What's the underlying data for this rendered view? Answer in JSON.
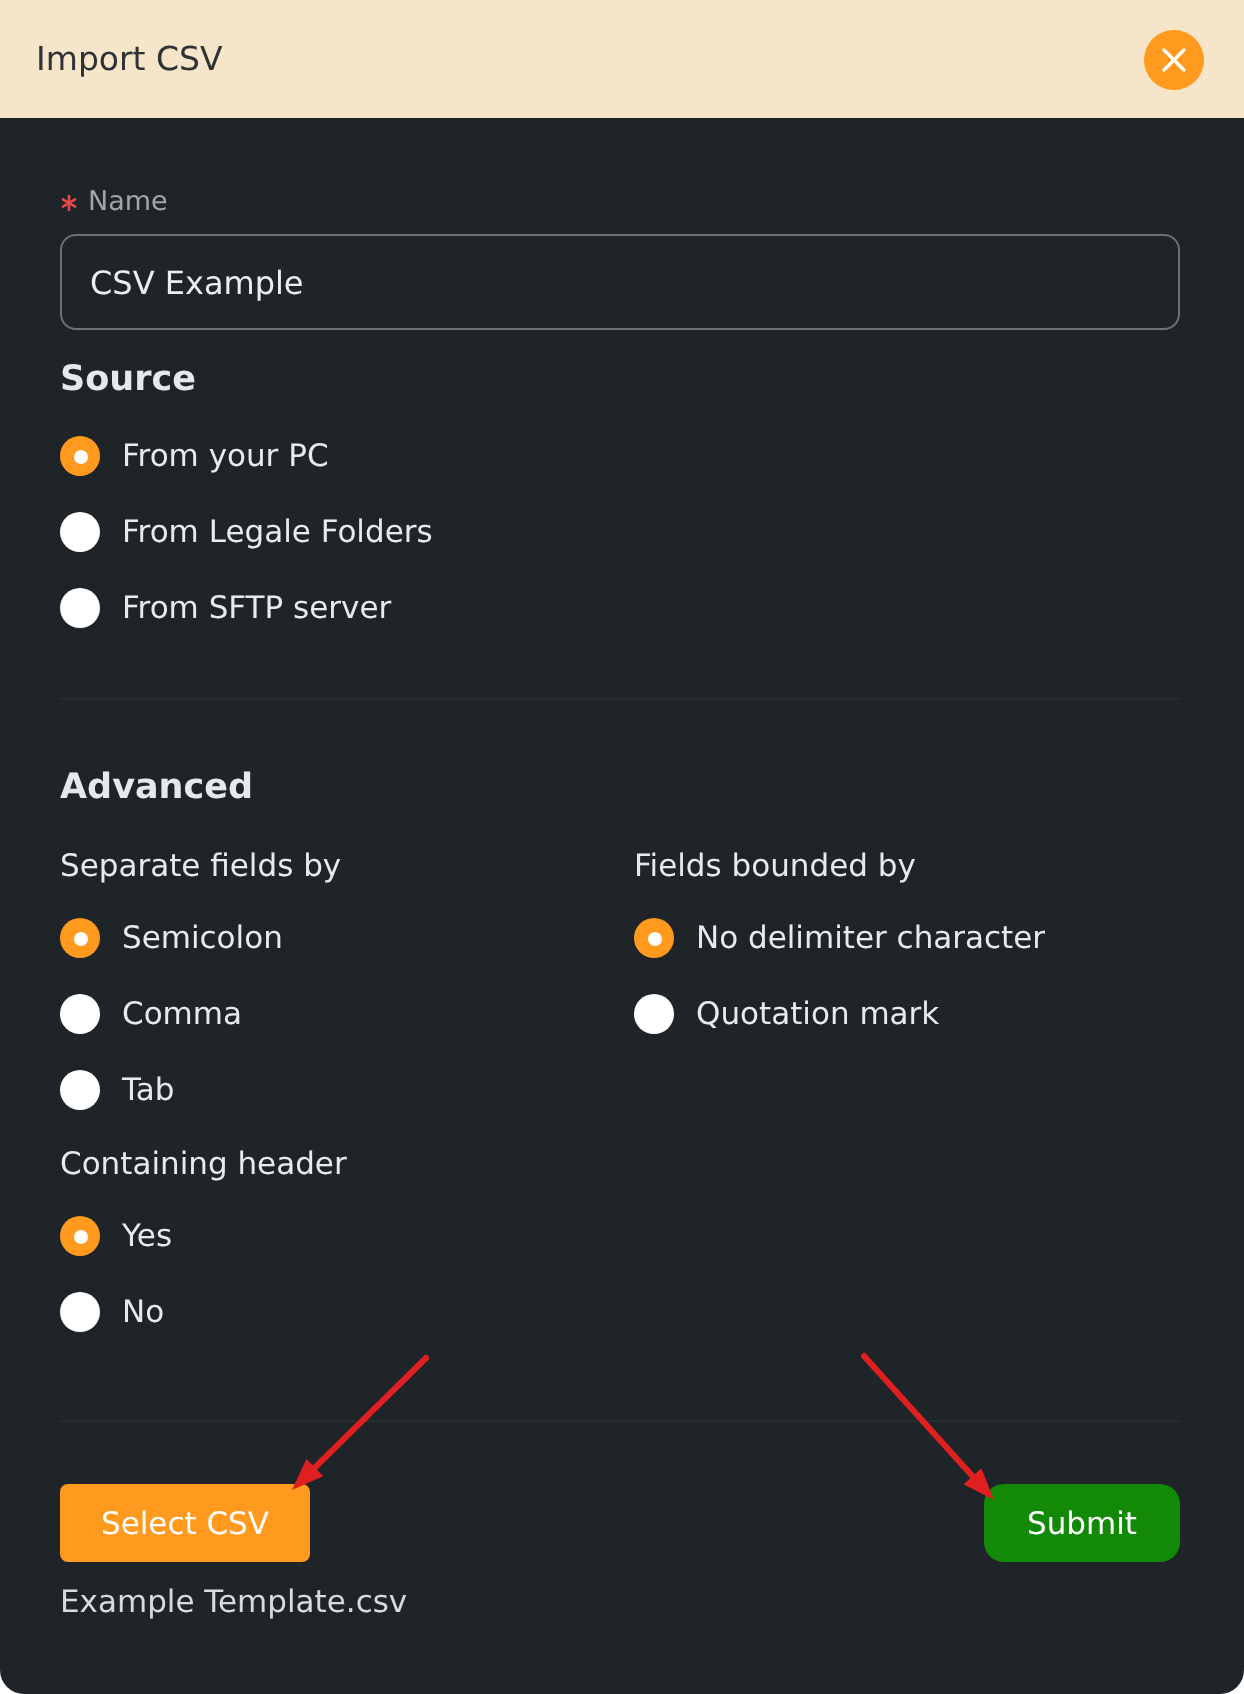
{
  "dialog": {
    "title": "Import CSV"
  },
  "name_field": {
    "label": "Name",
    "required": true,
    "value": "CSV Example"
  },
  "source": {
    "heading": "Source",
    "options": [
      {
        "label": "From your PC",
        "selected": true
      },
      {
        "label": "From Legale Folders",
        "selected": false
      },
      {
        "label": "From SFTP server",
        "selected": false
      }
    ]
  },
  "advanced": {
    "heading": "Advanced",
    "groups": [
      {
        "label": "Separate fields by",
        "options": [
          {
            "label": "Semicolon",
            "selected": true
          },
          {
            "label": "Comma",
            "selected": false
          },
          {
            "label": "Tab",
            "selected": false
          }
        ]
      },
      {
        "label": "Fields bounded by",
        "options": [
          {
            "label": "No delimiter character",
            "selected": true
          },
          {
            "label": "Quotation mark",
            "selected": false
          }
        ]
      },
      {
        "label": "Containing header",
        "options": [
          {
            "label": "Yes",
            "selected": true
          },
          {
            "label": "No",
            "selected": false
          }
        ]
      }
    ]
  },
  "actions": {
    "select_button": "Select CSV",
    "file_name": "Example Template.csv",
    "submit_button": "Submit"
  }
}
